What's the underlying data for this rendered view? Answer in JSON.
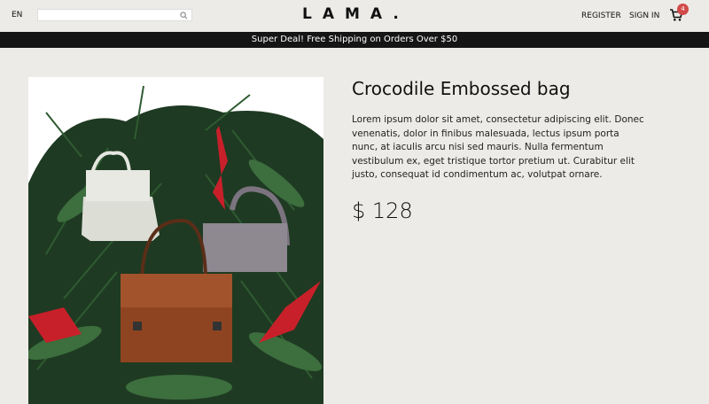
{
  "navbar": {
    "language": "EN",
    "search_placeholder": "",
    "logo": "LAMA.",
    "register_label": "REGISTER",
    "signin_label": "SIGN IN",
    "cart_count": "4"
  },
  "announcement": "Super Deal! Free Shipping on Orders Over $50",
  "product": {
    "title": "Crocodile Embossed bag",
    "description": "Lorem ipsum dolor sit amet, consectetur adipiscing elit. Donec venenatis, dolor in finibus malesuada, lectus ipsum porta nunc, at iaculis arcu nisi sed mauris. Nulla fermentum vestibulum ex, eget tristique tortor pretium ut. Curabitur elit justo, consequat id condimentum ac, volutpat ornare.",
    "price": "$ 128"
  },
  "colors": {
    "background": "#ecebe7",
    "announcement_bg": "#151515",
    "badge": "#d24a4a"
  },
  "icons": [
    "search-icon",
    "cart-icon"
  ]
}
